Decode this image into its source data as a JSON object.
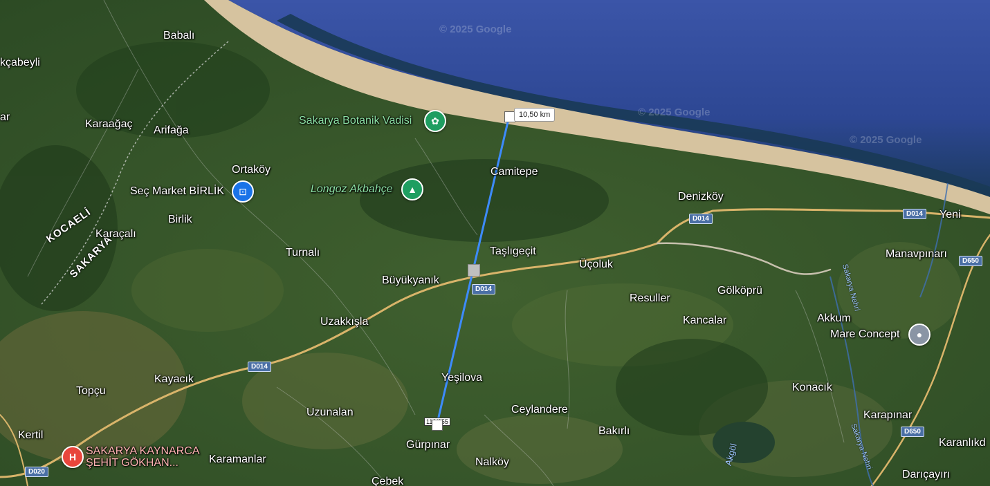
{
  "map": {
    "copyright": [
      "© 2025 Google",
      "© 2025 Google",
      "© 2025 Google"
    ],
    "places": [
      {
        "id": "babali",
        "text": "Babalı"
      },
      {
        "id": "kcabeyli",
        "text": "kçabeyli"
      },
      {
        "id": "ar",
        "text": "ar"
      },
      {
        "id": "karaagac",
        "text": "Karaağaç"
      },
      {
        "id": "arifaga",
        "text": "Arifağa"
      },
      {
        "id": "ortakoy",
        "text": "Ortaköy"
      },
      {
        "id": "camitepe",
        "text": "Camitepe"
      },
      {
        "id": "birlik",
        "text": "Birlik"
      },
      {
        "id": "karacali",
        "text": "Karaçalı"
      },
      {
        "id": "turnali",
        "text": "Turnalı"
      },
      {
        "id": "taslicecit",
        "text": "Taşlıgeçit"
      },
      {
        "id": "ucoluk",
        "text": "Üçoluk"
      },
      {
        "id": "buyukyanik",
        "text": "Büyükyanık"
      },
      {
        "id": "denizkoy",
        "text": "Denizköy"
      },
      {
        "id": "yeni",
        "text": "Yeni"
      },
      {
        "id": "manavpinari",
        "text": "Manavpınarı"
      },
      {
        "id": "gokopru",
        "text": "Gölköprü"
      },
      {
        "id": "resuller",
        "text": "Resuller"
      },
      {
        "id": "kancalar",
        "text": "Kancalar"
      },
      {
        "id": "uzakkisla",
        "text": "Uzakkışla"
      },
      {
        "id": "akkum",
        "text": "Akkum"
      },
      {
        "id": "konacik",
        "text": "Konacık"
      },
      {
        "id": "kayacik",
        "text": "Kayacık"
      },
      {
        "id": "yesilova",
        "text": "Yeşilova"
      },
      {
        "id": "topcu",
        "text": "Topçu"
      },
      {
        "id": "uzunalan",
        "text": "Uzunalan"
      },
      {
        "id": "ceylandere",
        "text": "Ceylandere"
      },
      {
        "id": "karapinar",
        "text": "Karapınar"
      },
      {
        "id": "kertil",
        "text": "Kertil"
      },
      {
        "id": "bakirli",
        "text": "Bakırlı"
      },
      {
        "id": "gurpinar",
        "text": "Gürpınar"
      },
      {
        "id": "karanlikdere",
        "text": "Karanlıkd"
      },
      {
        "id": "karamanlar",
        "text": "Karamanlar"
      },
      {
        "id": "nalkoy",
        "text": "Nalköy"
      },
      {
        "id": "cebek",
        "text": "Çebek"
      },
      {
        "id": "daricayiri",
        "text": "Darıçayırı"
      }
    ],
    "regions": {
      "kocaeli": "KOCAELİ",
      "sakarya": "SAKARYA"
    },
    "rivers": {
      "sakarya": "Sakarya Nehri",
      "sakarya2": "Sakarya Nehri",
      "akgol": "Akgöl"
    },
    "pois": {
      "botanik": {
        "label": "Sakarya Botanik Vadisi",
        "icon": "flower-icon"
      },
      "longoz": {
        "label": "Longoz Akbahçe",
        "icon": "tree-icon"
      },
      "secmarket": {
        "label": "Seç Market BİRLİK",
        "icon": "shopping-bag-icon"
      },
      "mare": {
        "label": "Mare Concept",
        "icon": "location-pin-icon"
      },
      "hospital": {
        "label_line1": "SAKARYA KAYNARCA",
        "label_line2": "ŞEHİT GÖKHAN...",
        "icon": "hospital-icon"
      }
    },
    "shields": [
      "D014",
      "D014",
      "D014",
      "D014",
      "D650",
      "D650",
      "D020"
    ]
  },
  "measure": {
    "distance_label": "10,50 km",
    "count_label": "113/255"
  },
  "colors": {
    "sea": "#2f4ea0",
    "sea_dark": "#1a3360",
    "beach": "#d8c4a0",
    "land": "#3a5a2c",
    "road": "#d9b46a",
    "measure_line": "#3d8bfd",
    "poi_green": "#1e9e61",
    "poi_blue": "#1a73e8",
    "poi_red": "#e8453c"
  }
}
